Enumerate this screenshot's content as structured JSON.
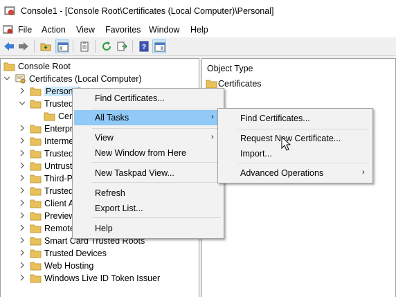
{
  "window": {
    "title": "Console1 - [Console Root\\Certificates (Local Computer)\\Personal]"
  },
  "menubar": {
    "items": [
      "File",
      "Action",
      "View",
      "Favorites",
      "Window",
      "Help"
    ]
  },
  "tree": {
    "root": "Console Root",
    "certificates": "Certificates (Local Computer)",
    "items": [
      "Personal",
      "Trusted",
      "Cer",
      "Enterpr",
      "Interme",
      "Trusted",
      "Untrust",
      "Third-P",
      "Trusted",
      "Client A",
      "Preview",
      "Remote",
      "Smart Card Trusted Roots",
      "Trusted Devices",
      "Web Hosting",
      "Windows Live ID Token Issuer"
    ]
  },
  "right_pane": {
    "header": "Object Type",
    "rows": [
      "Certificates"
    ]
  },
  "context_menu": {
    "items": [
      "Find Certificates...",
      "All Tasks",
      "View",
      "New Window from Here",
      "New Taskpad View...",
      "Refresh",
      "Export List...",
      "Help"
    ]
  },
  "submenu": {
    "items": [
      "Find Certificates...",
      "Request New Certificate...",
      "Import...",
      "Advanced Operations"
    ]
  },
  "colors": {
    "highlight": "#91c9f7",
    "folder": "#e8c15a",
    "menu_bg": "#f2f2f2"
  }
}
